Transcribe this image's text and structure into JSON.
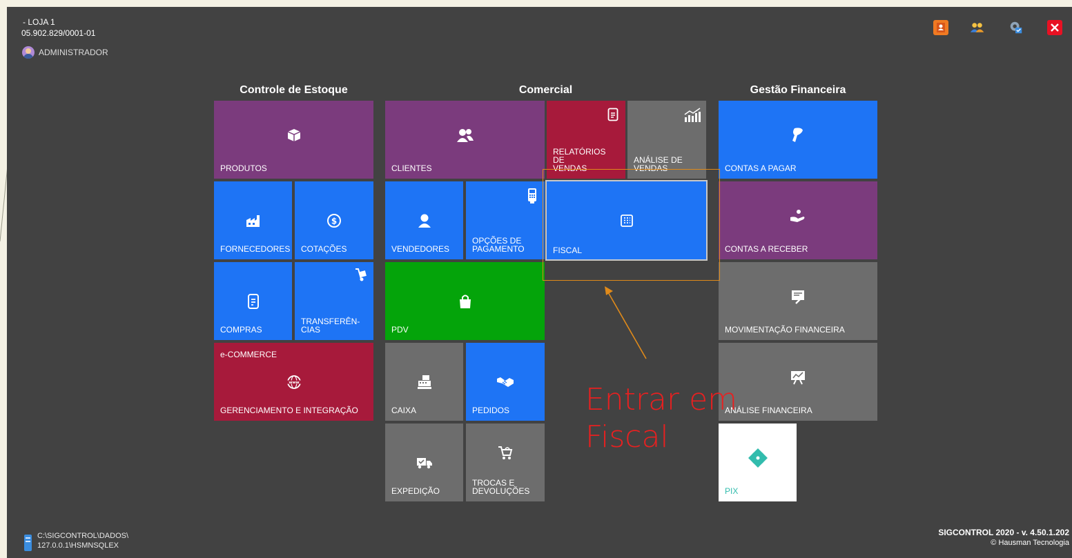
{
  "header": {
    "store_name": "- LOJA 1",
    "cnpj": "05.902.829/0001-01",
    "user": "ADMINISTRADOR"
  },
  "toolbar": {
    "icons": [
      "contacts-icon",
      "users-icon",
      "settings-icon",
      "close-icon"
    ],
    "close_color": "#e81123"
  },
  "groups": {
    "estoque": "Controle de Estoque",
    "comercial": "Comercial",
    "financeira": "Gestão Financeira"
  },
  "tiles": {
    "produtos": "PRODUTOS",
    "fornecedores": "FORNECEDORES",
    "cotacoes": "COTAÇÕES",
    "compras": "COMPRAS",
    "transferencias_1": "TRANSFERÊN-",
    "transferencias_2": "CIAS",
    "ecommerce_top": "e-COMMERCE",
    "ecommerce": "GERENCIAMENTO E INTEGRAÇÃO",
    "clientes": "CLIENTES",
    "relatorios_1": "RELATÓRIOS DE",
    "relatorios_2": "VENDAS",
    "analise_1": "ANÁLISE DE",
    "analise_2": "VENDAS",
    "vendedores": "VENDEDORES",
    "opcoes_1": "OPÇÕES DE",
    "opcoes_2": "PAGAMENTO",
    "fiscal": "FISCAL",
    "pdv": "PDV",
    "caixa": "CAIXA",
    "pedidos": "PEDIDOS",
    "expedicao": "EXPEDIÇÃO",
    "trocas_1": "TROCAS E",
    "trocas_2": "DEVOLUÇÕES",
    "contas_pagar": "CONTAS A PAGAR",
    "contas_receber": "CONTAS A RECEBER",
    "mov_fin": "MOVIMENTAÇÃO FINANCEIRA",
    "analise_fin": "ANÁLISE FINANCEIRA",
    "pix": "PIX"
  },
  "annotation": {
    "line1": "Entrar em",
    "line2": "Fiscal",
    "color": "#e82020",
    "highlight_color": "#e08a1a"
  },
  "footer": {
    "path": "C:\\SIGCONTROL\\DADOS\\",
    "server": "127.0.0.1\\HSMNSQLEX",
    "version": "SIGCONTROL 2020 - v. 4.50.1.202",
    "copyright": "© Hausman Tecnologia"
  },
  "colors": {
    "background": "#424242",
    "purple": "#7b3b7d",
    "blue": "#1e74f5",
    "green": "#04a40a",
    "crimson": "#a71a3b",
    "gray": "#6d6d6d",
    "pix_teal": "#32bcad"
  }
}
